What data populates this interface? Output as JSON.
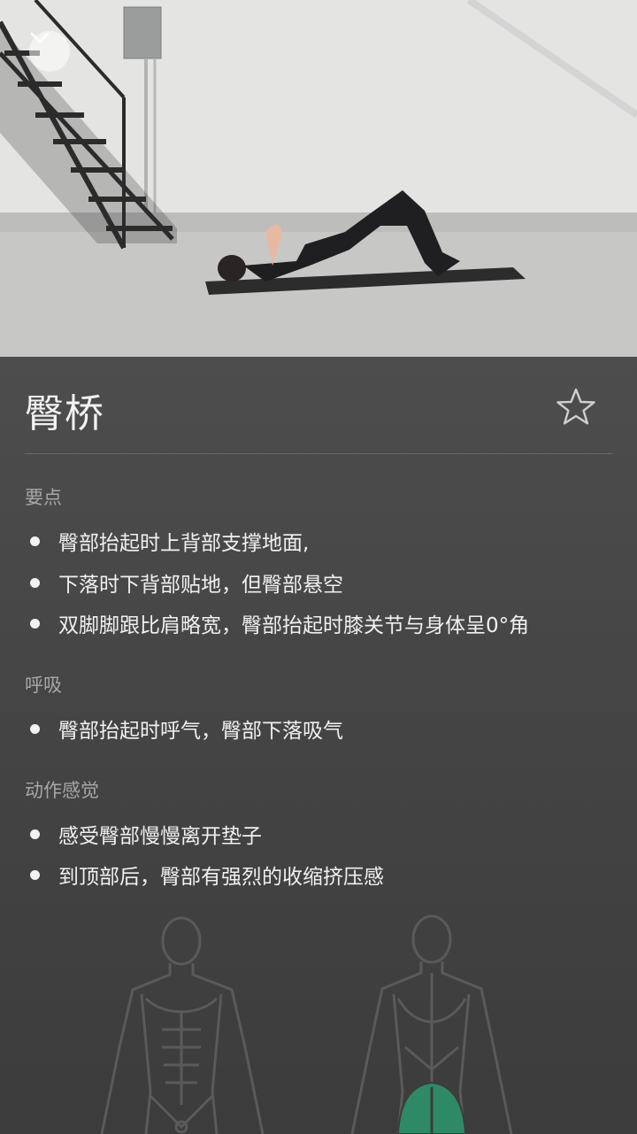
{
  "exercise": {
    "title": "臀桥",
    "favorite_icon": "star-outline-icon"
  },
  "video": {
    "collapse_icon": "chevron-down-icon"
  },
  "sections": [
    {
      "heading": "要点",
      "items": [
        "臀部抬起时上背部支撑地面,",
        "下落时下背部贴地，但臀部悬空",
        "双脚脚跟比肩略宽，臀部抬起时膝关节与身体呈0°角"
      ]
    },
    {
      "heading": "呼吸",
      "items": [
        "臀部抬起时呼气，臀部下落吸气"
      ]
    },
    {
      "heading": "动作感觉",
      "items": [
        "感受臀部慢慢离开垫子",
        "到顶部后，臀部有强烈的收缩挤压感"
      ]
    }
  ],
  "colors": {
    "background": "#3f3f3f",
    "text": "#f0f0f0",
    "section_heading": "#a7a7a7",
    "highlight_muscle": "#2e8a66"
  }
}
